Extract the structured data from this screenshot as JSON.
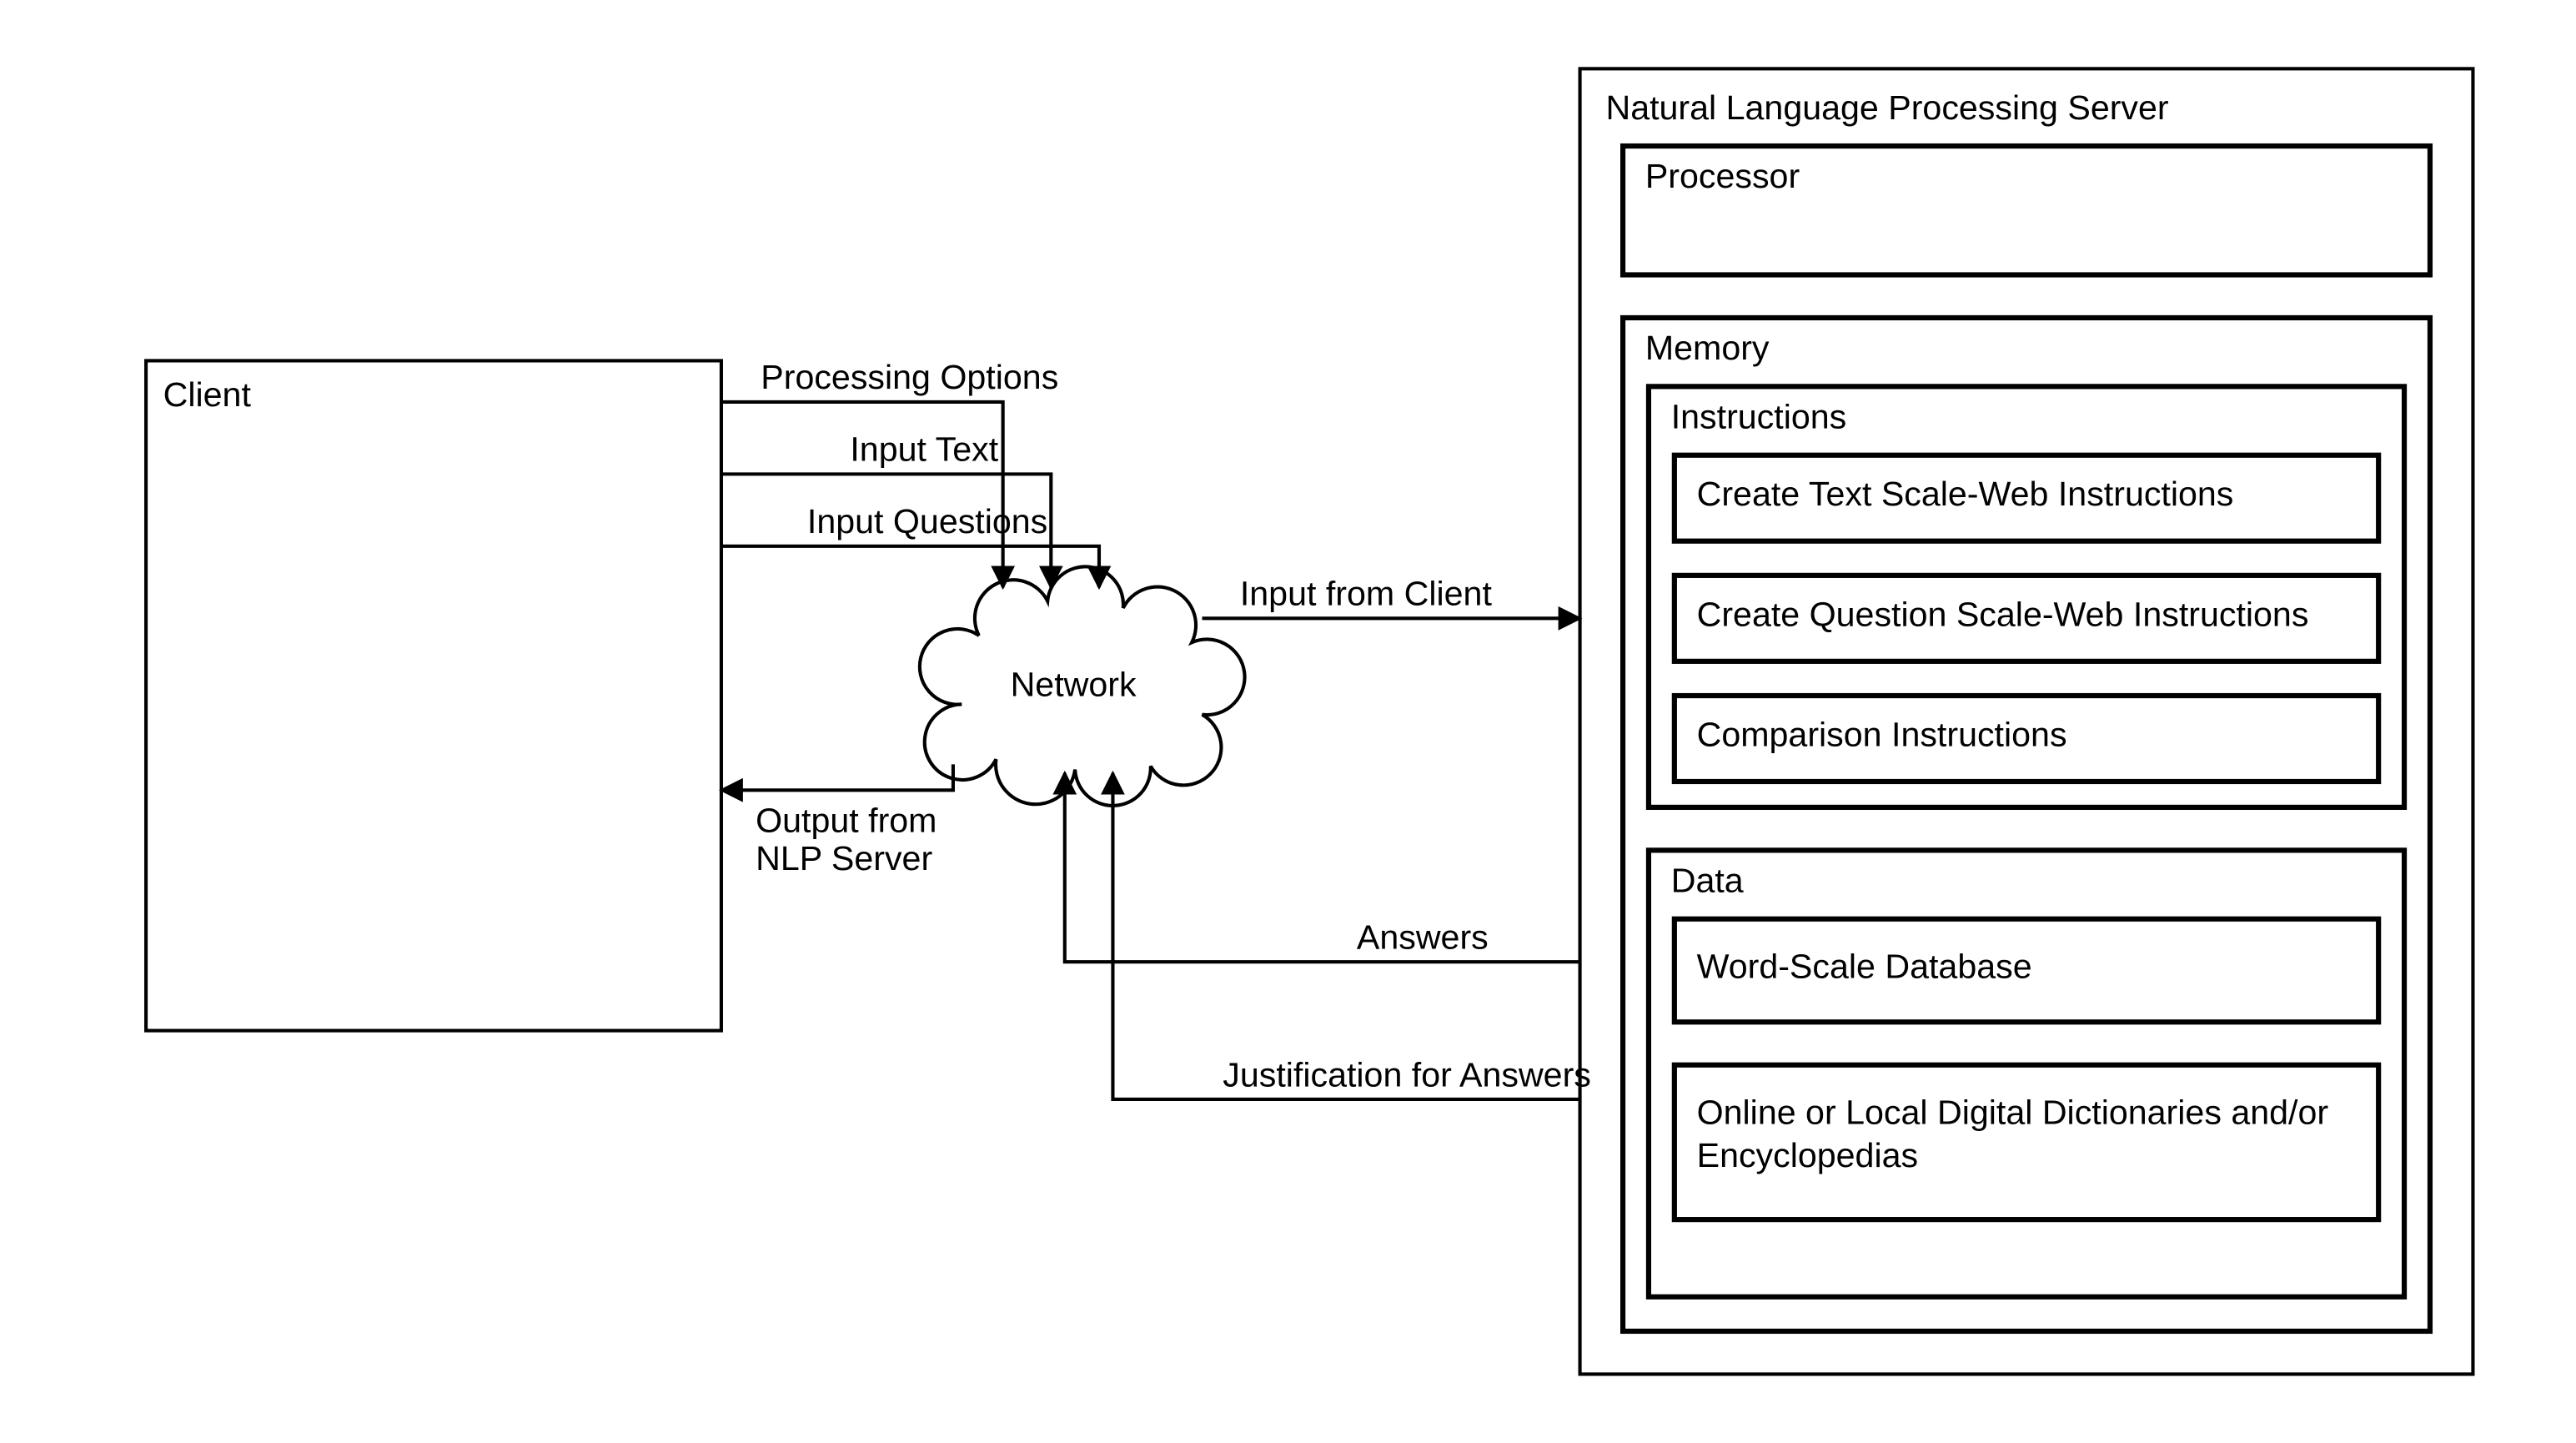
{
  "client": {
    "title": "Client"
  },
  "network": {
    "title": "Network"
  },
  "server": {
    "title": "Natural Language Processing Server",
    "processor": {
      "title": "Processor"
    },
    "memory": {
      "title": "Memory",
      "instructions": {
        "title": "Instructions",
        "items": [
          "Create Text Scale-Web Instructions",
          "Create Question Scale-Web Instructions",
          "Comparison Instructions"
        ]
      },
      "data": {
        "title": "Data",
        "items": [
          "Word-Scale Database",
          "Online or Local Digital Dictionaries and/or Encyclopedias"
        ]
      }
    }
  },
  "edges": {
    "client_to_network": [
      "Processing Options",
      "Input Text",
      "Input Questions"
    ],
    "network_to_client": "Output from NLP Server",
    "network_to_server": "Input from Client",
    "server_to_network": [
      "Answers",
      "Justification for Answers"
    ]
  }
}
